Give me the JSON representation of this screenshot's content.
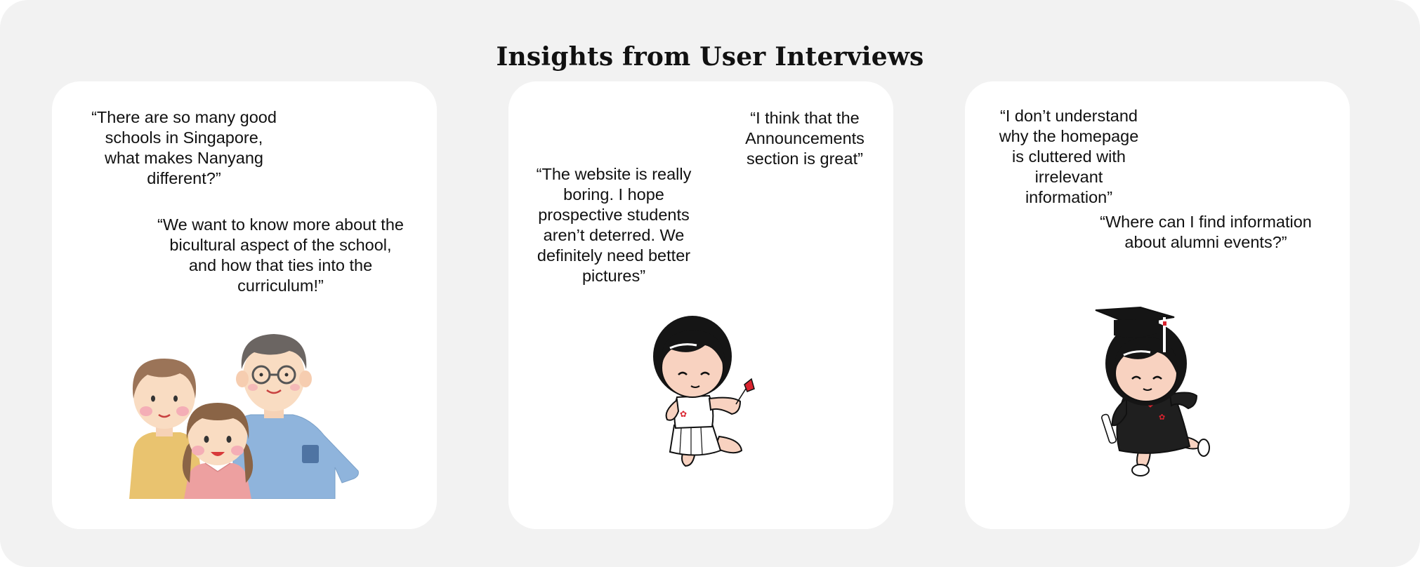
{
  "page": {
    "title": "Insights from User Interviews"
  },
  "cards": [
    {
      "illustration": "family-illustration",
      "quotes": [
        "“There are so many good schools in Singapore, what makes Nanyang different?”",
        "“We want to know more about the bicultural aspect of the school, and how that ties into the curriculum!”"
      ]
    },
    {
      "illustration": "student-girl-flower-illustration",
      "quotes": [
        "“I think that the Announcements section is great”",
        "“The website is really boring. I hope prospective students aren’t deterred. We definitely need better pictures”"
      ]
    },
    {
      "illustration": "graduate-girl-illustration",
      "quotes": [
        "“I don’t understand why the homepage is cluttered with irrelevant information”",
        "“Where can I find information about alumni events?”"
      ]
    }
  ],
  "colors": {
    "background": "#f2f2f2",
    "card": "#ffffff",
    "text": "#111111",
    "accent_red": "#d9232e"
  }
}
